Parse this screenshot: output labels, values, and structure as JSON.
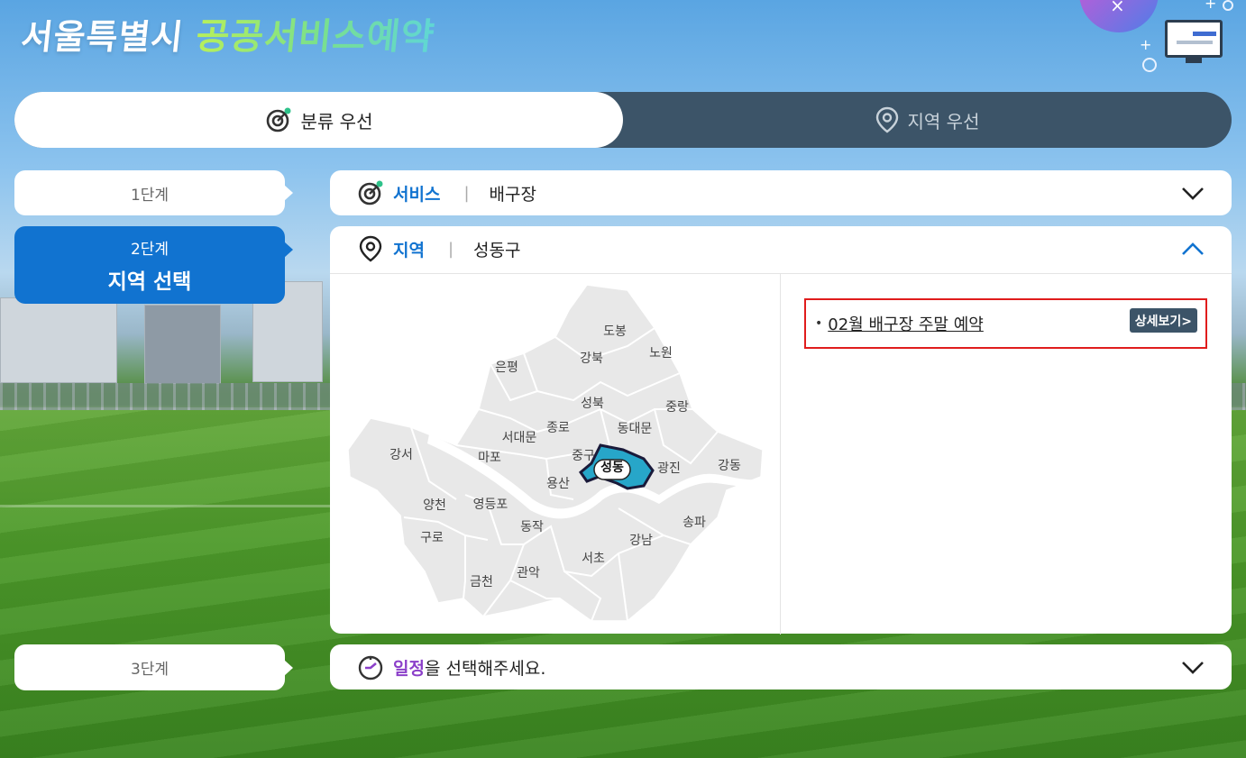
{
  "logo": {
    "part1": "서울특별시",
    "part2": "공공서비스예약"
  },
  "mode_toggle": {
    "tabs": [
      {
        "label": "분류 우선",
        "active": true,
        "icon": "target-icon"
      },
      {
        "label": "지역 우선",
        "active": false,
        "icon": "location-pin-icon"
      }
    ]
  },
  "steps": [
    {
      "num": "1단계",
      "title": ""
    },
    {
      "num": "2단계",
      "title": "지역 선택",
      "active": true
    },
    {
      "num": "3단계",
      "title": ""
    }
  ],
  "service_panel": {
    "key": "서비스",
    "value": "배구장",
    "icon": "target-icon",
    "expanded": false
  },
  "region_panel": {
    "key": "지역",
    "value": "성동구",
    "icon": "location-pin-icon",
    "expanded": true
  },
  "map": {
    "districts": [
      "도봉",
      "노원",
      "강북",
      "은평",
      "성북",
      "중랑",
      "종로",
      "동대문",
      "서대문",
      "마포",
      "중구",
      "성동",
      "광진",
      "강동",
      "강서",
      "용산",
      "양천",
      "영등포",
      "동작",
      "송파",
      "구로",
      "강남",
      "서초",
      "관악",
      "금천"
    ],
    "selected": "성동",
    "selected_color": "#27a6c9"
  },
  "results": [
    {
      "title": "02월 배구장 주말 예약",
      "detail_label": "상세보기>"
    }
  ],
  "schedule_panel": {
    "key": "일정",
    "rest": "을 선택해주세요.",
    "icon": "clock-icon",
    "expanded": false
  },
  "colors": {
    "primary": "#1173d0",
    "dark": "#3c5468",
    "accent_purple": "#8b3fc9",
    "highlight_border": "#e01d1d"
  }
}
